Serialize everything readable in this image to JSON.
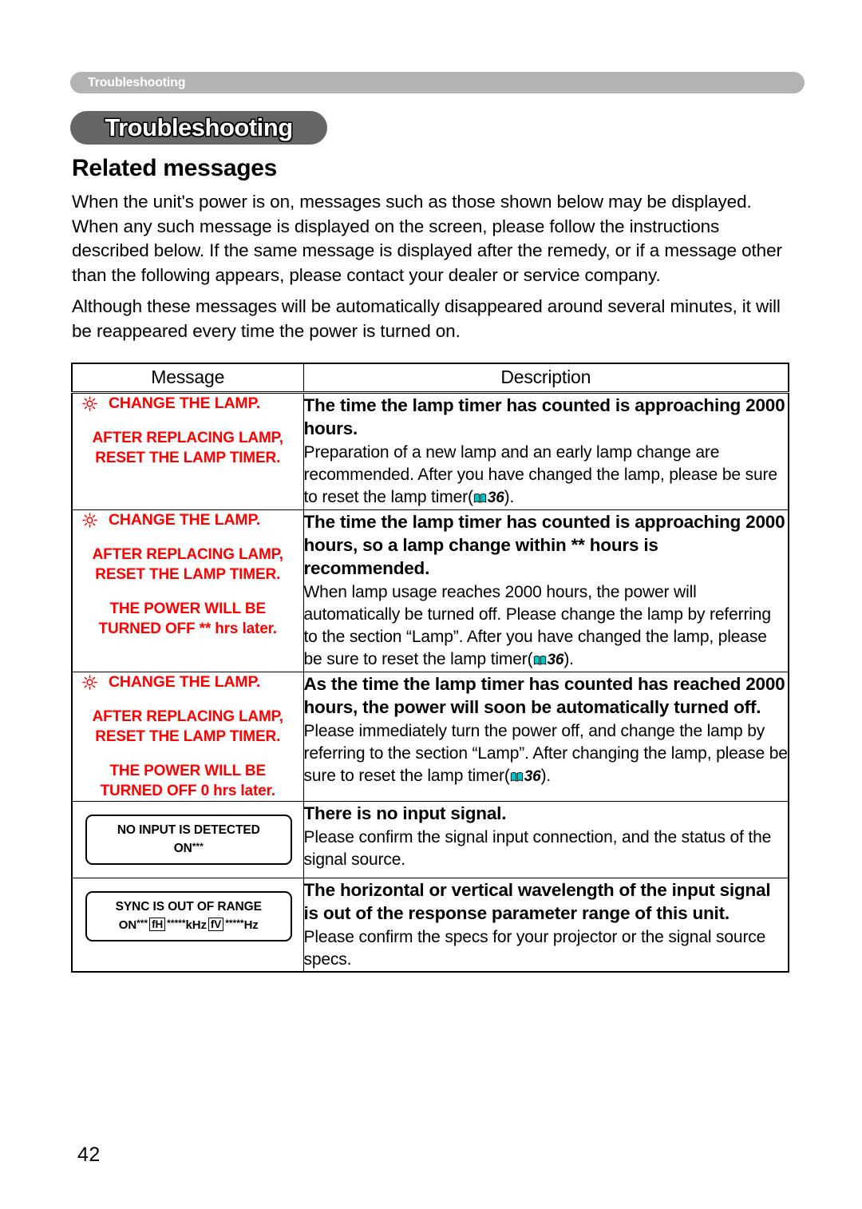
{
  "running_header": {
    "label": "Troubleshooting"
  },
  "chapter": {
    "title": "Troubleshooting"
  },
  "section": {
    "heading": "Related messages"
  },
  "intro": {
    "paragraph_1": "When the unit's power is on, messages such as those shown below may be displayed. When any such message is displayed on the screen, please follow the instructions described below. If the same message is displayed after the remedy, or if a message other than the following appears, please contact your dealer or service company.",
    "paragraph_2": "Although these messages will be automatically disappeared around several minutes, it will be reappeared every time the power is turned on."
  },
  "table": {
    "headers": {
      "message": "Message",
      "description": "Description"
    },
    "rows": [
      {
        "message": {
          "type": "lamp",
          "icon": "lamp-sun-icon",
          "line_1": "CHANGE THE LAMP.",
          "block_1": "AFTER REPLACING LAMP,",
          "block_2": "RESET THE LAMP TIMER.",
          "block_3": "",
          "block_4": ""
        },
        "description": {
          "strong": "The time the lamp timer has counted is approaching 2000 hours.",
          "body_before": "Preparation of a new lamp and an early lamp change are recommended. After you have changed the lamp, please be sure to reset the lamp timer(",
          "page_ref": "36",
          "body_after": ")."
        }
      },
      {
        "message": {
          "type": "lamp",
          "icon": "lamp-sun-icon",
          "line_1": "CHANGE THE LAMP.",
          "block_1": "AFTER REPLACING LAMP,",
          "block_2": "RESET THE LAMP TIMER.",
          "block_3": "THE POWER WILL BE",
          "block_4": "TURNED OFF ** hrs later."
        },
        "description": {
          "strong": "The time the lamp timer has counted is approaching 2000 hours, so a lamp change within ** hours is recommended.",
          "body_before": "When lamp usage reaches 2000 hours, the power will automatically be turned off. Please change the lamp by referring to the section “Lamp”. After you have changed the lamp, please be sure to reset the lamp timer(",
          "page_ref": "36",
          "body_after": ")."
        }
      },
      {
        "message": {
          "type": "lamp",
          "icon": "lamp-sun-icon",
          "line_1": "CHANGE THE LAMP.",
          "block_1": "AFTER REPLACING LAMP,",
          "block_2": "RESET THE LAMP TIMER.",
          "block_3": "THE POWER WILL BE",
          "block_4": "TURNED OFF 0 hrs later."
        },
        "description": {
          "strong": "As the time the lamp timer has counted has reached 2000 hours, the power will soon be automatically turned off.",
          "body_before": "Please immediately turn the power off, and change the lamp by referring to the section “Lamp”. After changing the lamp, please be sure to reset the lamp timer(",
          "page_ref": "36",
          "body_after": ")."
        }
      },
      {
        "message": {
          "type": "osd",
          "osd_line_1": "NO INPUT IS DETECTED",
          "osd_line_2_prefix": "ON",
          "osd_line_2_stars": "***"
        },
        "description": {
          "strong": "There is no input signal.",
          "body_before": "Please confirm the signal input connection, and the status of the signal source.",
          "page_ref": "",
          "body_after": ""
        }
      },
      {
        "message": {
          "type": "osd-sync",
          "osd_line_1": "SYNC IS OUT OF RANGE",
          "osd_on": "ON",
          "osd_on_stars": "***",
          "osd_tag_h": "fH",
          "osd_khz_stars": "*****",
          "osd_khz": "kHz",
          "osd_tag_v": "fV",
          "osd_hz_stars": "*****",
          "osd_hz": "Hz"
        },
        "description": {
          "strong": "The horizontal or vertical wavelength of the input signal is out of the response parameter range of this unit.",
          "body_before": "Please confirm the specs for your projector or the signal source specs.",
          "page_ref": "",
          "body_after": ""
        }
      }
    ]
  },
  "folio": {
    "page_number": "42"
  },
  "colors": {
    "alert_red": "#ff0000",
    "running_header_bg": "#b3b3b3",
    "chapter_pill_bg": "#666666",
    "book_icon": "#00c8c8"
  }
}
